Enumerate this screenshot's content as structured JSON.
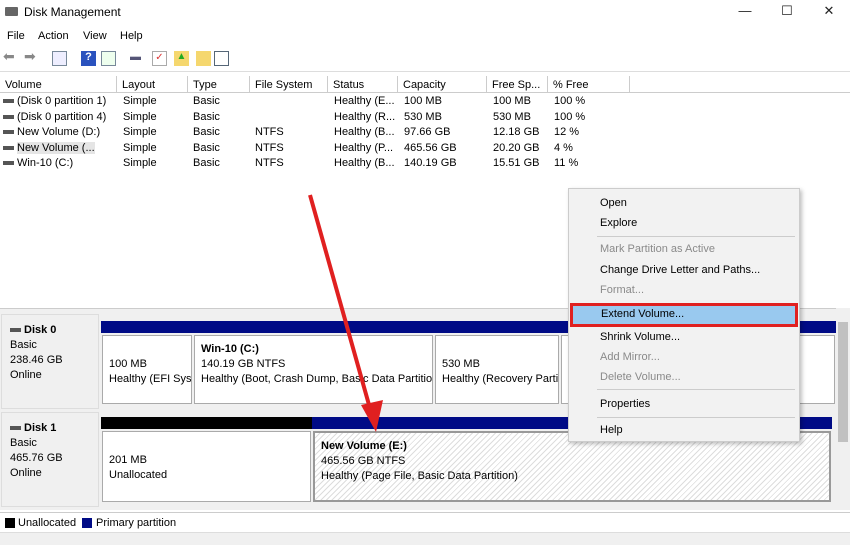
{
  "window": {
    "title": "Disk Management",
    "minimize": "—",
    "maximize": "☐",
    "close": "✕"
  },
  "menu": [
    "File",
    "Action",
    "View",
    "Help"
  ],
  "columns": [
    "Volume",
    "Layout",
    "Type",
    "File System",
    "Status",
    "Capacity",
    "Free Sp...",
    "% Free"
  ],
  "volumes": [
    [
      "(Disk 0 partition 1)",
      "Simple",
      "Basic",
      "",
      "Healthy (E...",
      "100 MB",
      "100 MB",
      "100 %"
    ],
    [
      "(Disk 0 partition 4)",
      "Simple",
      "Basic",
      "",
      "Healthy (R...",
      "530 MB",
      "530 MB",
      "100 %"
    ],
    [
      "New Volume (D:)",
      "Simple",
      "Basic",
      "NTFS",
      "Healthy (B...",
      "97.66 GB",
      "12.18 GB",
      "12 %"
    ],
    [
      "New Volume (...",
      "Simple",
      "Basic",
      "NTFS",
      "Healthy (P...",
      "465.56 GB",
      "20.20 GB",
      "4 %"
    ],
    [
      "Win-10 (C:)",
      "Simple",
      "Basic",
      "NTFS",
      "Healthy (B...",
      "140.19 GB",
      "15.51 GB",
      "11 %"
    ]
  ],
  "disks": [
    {
      "name": "Disk 0",
      "type": "Basic",
      "size": "238.46 GB",
      "state": "Online",
      "partitions": [
        {
          "title": "",
          "size": "100 MB",
          "status": "Healthy (EFI Sys"
        },
        {
          "title": "Win-10  (C:)",
          "size": "140.19 GB NTFS",
          "status": "Healthy (Boot, Crash Dump, Basic Data Partitio"
        },
        {
          "title": "",
          "size": "530 MB",
          "status": "Healthy (Recovery Parti"
        }
      ]
    },
    {
      "name": "Disk 1",
      "type": "Basic",
      "size": "465.76 GB",
      "state": "Online",
      "partitions": [
        {
          "title": "",
          "size": "201 MB",
          "status": "Unallocated"
        },
        {
          "title": "New Volume  (E:)",
          "size": "465.56 GB NTFS",
          "status": "Healthy (Page File, Basic Data Partition)"
        }
      ]
    }
  ],
  "legend": {
    "unallocated": "Unallocated",
    "primary": "Primary partition"
  },
  "context_menu": {
    "open": "Open",
    "explore": "Explore",
    "mark_active": "Mark Partition as Active",
    "change_letter": "Change Drive Letter and Paths...",
    "format": "Format...",
    "extend": "Extend Volume...",
    "shrink": "Shrink Volume...",
    "add_mirror": "Add Mirror...",
    "delete": "Delete Volume...",
    "properties": "Properties",
    "help": "Help"
  },
  "colors": {
    "primary": "#000b86",
    "unallocated": "#000000",
    "highlight": "#99c9ef",
    "annotation": "#e02020"
  }
}
